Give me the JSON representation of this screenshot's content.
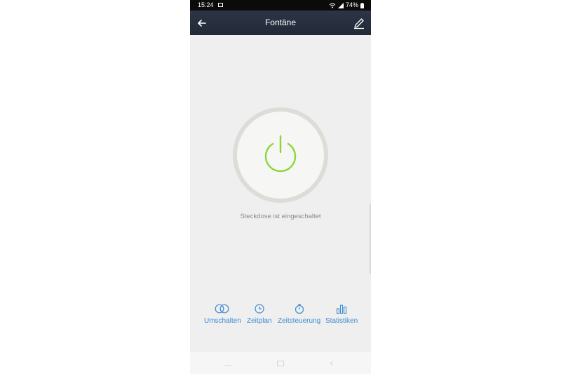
{
  "status_bar": {
    "time": "15:24",
    "battery": "74%"
  },
  "app_bar": {
    "title": "Fontäne"
  },
  "device": {
    "power_state_text": "Steckdose ist eingeschaltet"
  },
  "colors": {
    "app_bar": "#2c3546",
    "power_on": "#8cd63c",
    "accent": "#3f8bd0",
    "background": "#efefef"
  },
  "bottom_nav": {
    "items": [
      {
        "label": "Umschalten",
        "icon": "toggle-circles-icon"
      },
      {
        "label": "Zeitplan",
        "icon": "clock-icon"
      },
      {
        "label": "Zeitsteuerung",
        "icon": "stopwatch-icon"
      },
      {
        "label": "Statistiken",
        "icon": "bar-chart-icon"
      }
    ]
  }
}
